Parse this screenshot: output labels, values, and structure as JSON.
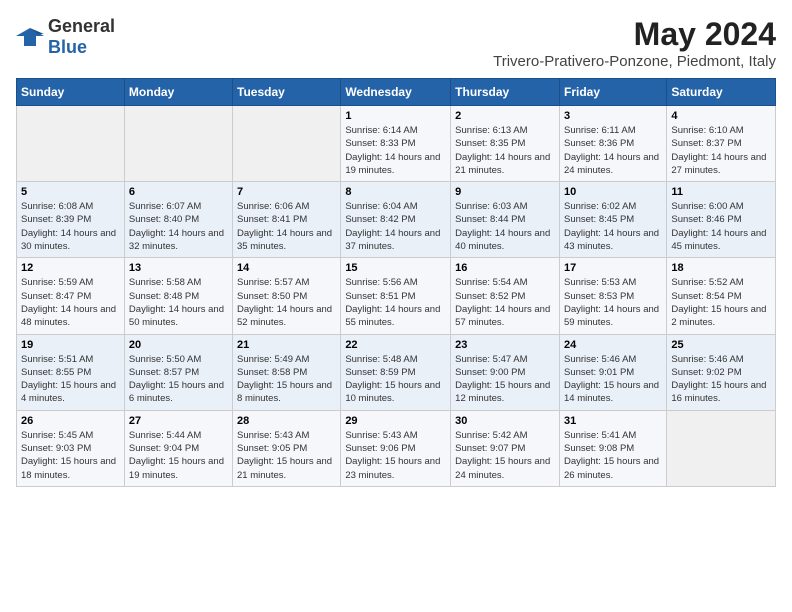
{
  "logo": {
    "text_general": "General",
    "text_blue": "Blue"
  },
  "header": {
    "month_year": "May 2024",
    "location": "Trivero-Prativero-Ponzone, Piedmont, Italy"
  },
  "weekdays": [
    "Sunday",
    "Monday",
    "Tuesday",
    "Wednesday",
    "Thursday",
    "Friday",
    "Saturday"
  ],
  "weeks": [
    [
      {
        "day": "",
        "sunrise": "",
        "sunset": "",
        "daylight": ""
      },
      {
        "day": "",
        "sunrise": "",
        "sunset": "",
        "daylight": ""
      },
      {
        "day": "",
        "sunrise": "",
        "sunset": "",
        "daylight": ""
      },
      {
        "day": "1",
        "sunrise": "Sunrise: 6:14 AM",
        "sunset": "Sunset: 8:33 PM",
        "daylight": "Daylight: 14 hours and 19 minutes."
      },
      {
        "day": "2",
        "sunrise": "Sunrise: 6:13 AM",
        "sunset": "Sunset: 8:35 PM",
        "daylight": "Daylight: 14 hours and 21 minutes."
      },
      {
        "day": "3",
        "sunrise": "Sunrise: 6:11 AM",
        "sunset": "Sunset: 8:36 PM",
        "daylight": "Daylight: 14 hours and 24 minutes."
      },
      {
        "day": "4",
        "sunrise": "Sunrise: 6:10 AM",
        "sunset": "Sunset: 8:37 PM",
        "daylight": "Daylight: 14 hours and 27 minutes."
      }
    ],
    [
      {
        "day": "5",
        "sunrise": "Sunrise: 6:08 AM",
        "sunset": "Sunset: 8:39 PM",
        "daylight": "Daylight: 14 hours and 30 minutes."
      },
      {
        "day": "6",
        "sunrise": "Sunrise: 6:07 AM",
        "sunset": "Sunset: 8:40 PM",
        "daylight": "Daylight: 14 hours and 32 minutes."
      },
      {
        "day": "7",
        "sunrise": "Sunrise: 6:06 AM",
        "sunset": "Sunset: 8:41 PM",
        "daylight": "Daylight: 14 hours and 35 minutes."
      },
      {
        "day": "8",
        "sunrise": "Sunrise: 6:04 AM",
        "sunset": "Sunset: 8:42 PM",
        "daylight": "Daylight: 14 hours and 37 minutes."
      },
      {
        "day": "9",
        "sunrise": "Sunrise: 6:03 AM",
        "sunset": "Sunset: 8:44 PM",
        "daylight": "Daylight: 14 hours and 40 minutes."
      },
      {
        "day": "10",
        "sunrise": "Sunrise: 6:02 AM",
        "sunset": "Sunset: 8:45 PM",
        "daylight": "Daylight: 14 hours and 43 minutes."
      },
      {
        "day": "11",
        "sunrise": "Sunrise: 6:00 AM",
        "sunset": "Sunset: 8:46 PM",
        "daylight": "Daylight: 14 hours and 45 minutes."
      }
    ],
    [
      {
        "day": "12",
        "sunrise": "Sunrise: 5:59 AM",
        "sunset": "Sunset: 8:47 PM",
        "daylight": "Daylight: 14 hours and 48 minutes."
      },
      {
        "day": "13",
        "sunrise": "Sunrise: 5:58 AM",
        "sunset": "Sunset: 8:48 PM",
        "daylight": "Daylight: 14 hours and 50 minutes."
      },
      {
        "day": "14",
        "sunrise": "Sunrise: 5:57 AM",
        "sunset": "Sunset: 8:50 PM",
        "daylight": "Daylight: 14 hours and 52 minutes."
      },
      {
        "day": "15",
        "sunrise": "Sunrise: 5:56 AM",
        "sunset": "Sunset: 8:51 PM",
        "daylight": "Daylight: 14 hours and 55 minutes."
      },
      {
        "day": "16",
        "sunrise": "Sunrise: 5:54 AM",
        "sunset": "Sunset: 8:52 PM",
        "daylight": "Daylight: 14 hours and 57 minutes."
      },
      {
        "day": "17",
        "sunrise": "Sunrise: 5:53 AM",
        "sunset": "Sunset: 8:53 PM",
        "daylight": "Daylight: 14 hours and 59 minutes."
      },
      {
        "day": "18",
        "sunrise": "Sunrise: 5:52 AM",
        "sunset": "Sunset: 8:54 PM",
        "daylight": "Daylight: 15 hours and 2 minutes."
      }
    ],
    [
      {
        "day": "19",
        "sunrise": "Sunrise: 5:51 AM",
        "sunset": "Sunset: 8:55 PM",
        "daylight": "Daylight: 15 hours and 4 minutes."
      },
      {
        "day": "20",
        "sunrise": "Sunrise: 5:50 AM",
        "sunset": "Sunset: 8:57 PM",
        "daylight": "Daylight: 15 hours and 6 minutes."
      },
      {
        "day": "21",
        "sunrise": "Sunrise: 5:49 AM",
        "sunset": "Sunset: 8:58 PM",
        "daylight": "Daylight: 15 hours and 8 minutes."
      },
      {
        "day": "22",
        "sunrise": "Sunrise: 5:48 AM",
        "sunset": "Sunset: 8:59 PM",
        "daylight": "Daylight: 15 hours and 10 minutes."
      },
      {
        "day": "23",
        "sunrise": "Sunrise: 5:47 AM",
        "sunset": "Sunset: 9:00 PM",
        "daylight": "Daylight: 15 hours and 12 minutes."
      },
      {
        "day": "24",
        "sunrise": "Sunrise: 5:46 AM",
        "sunset": "Sunset: 9:01 PM",
        "daylight": "Daylight: 15 hours and 14 minutes."
      },
      {
        "day": "25",
        "sunrise": "Sunrise: 5:46 AM",
        "sunset": "Sunset: 9:02 PM",
        "daylight": "Daylight: 15 hours and 16 minutes."
      }
    ],
    [
      {
        "day": "26",
        "sunrise": "Sunrise: 5:45 AM",
        "sunset": "Sunset: 9:03 PM",
        "daylight": "Daylight: 15 hours and 18 minutes."
      },
      {
        "day": "27",
        "sunrise": "Sunrise: 5:44 AM",
        "sunset": "Sunset: 9:04 PM",
        "daylight": "Daylight: 15 hours and 19 minutes."
      },
      {
        "day": "28",
        "sunrise": "Sunrise: 5:43 AM",
        "sunset": "Sunset: 9:05 PM",
        "daylight": "Daylight: 15 hours and 21 minutes."
      },
      {
        "day": "29",
        "sunrise": "Sunrise: 5:43 AM",
        "sunset": "Sunset: 9:06 PM",
        "daylight": "Daylight: 15 hours and 23 minutes."
      },
      {
        "day": "30",
        "sunrise": "Sunrise: 5:42 AM",
        "sunset": "Sunset: 9:07 PM",
        "daylight": "Daylight: 15 hours and 24 minutes."
      },
      {
        "day": "31",
        "sunrise": "Sunrise: 5:41 AM",
        "sunset": "Sunset: 9:08 PM",
        "daylight": "Daylight: 15 hours and 26 minutes."
      },
      {
        "day": "",
        "sunrise": "",
        "sunset": "",
        "daylight": ""
      }
    ]
  ]
}
